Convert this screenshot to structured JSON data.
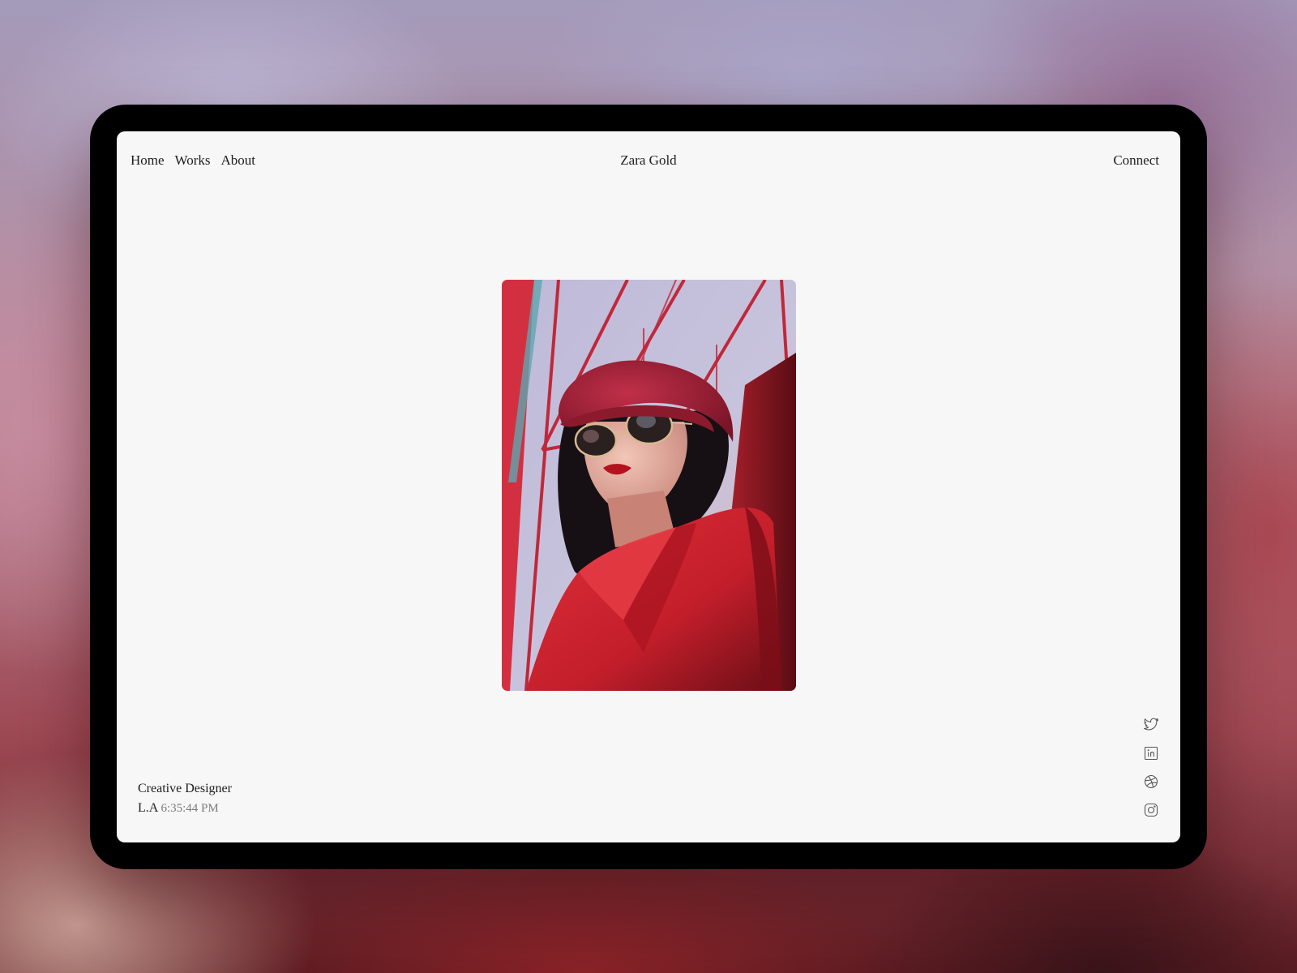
{
  "nav": {
    "links": [
      {
        "label": "Home"
      },
      {
        "label": "Works"
      },
      {
        "label": "About"
      }
    ],
    "brand": "Zara Gold",
    "connect": "Connect"
  },
  "hero": {
    "image_icon": "portrait-photo"
  },
  "bio": {
    "role": "Creative Designer",
    "location": "L.A",
    "time": "6:35:44 PM"
  },
  "socials": [
    {
      "icon": "twitter-icon"
    },
    {
      "icon": "linkedin-icon"
    },
    {
      "icon": "dribbble-icon"
    },
    {
      "icon": "instagram-icon"
    }
  ],
  "colors": {
    "screen_bg": "#f7f7f7",
    "text": "#1e1e1e",
    "muted_text": "#7a7a7a",
    "accent_red": "#c8202c"
  }
}
